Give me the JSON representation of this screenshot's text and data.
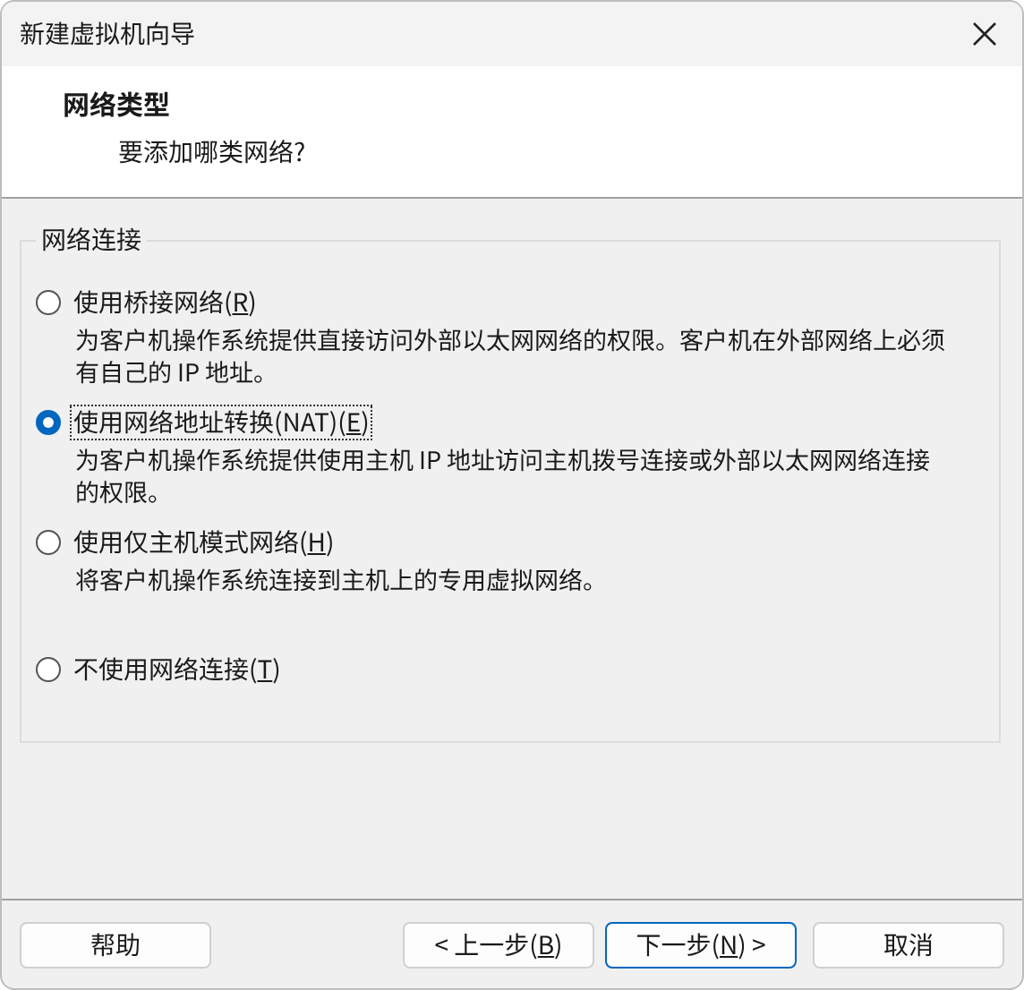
{
  "window": {
    "title": "新建虚拟机向导"
  },
  "header": {
    "title": "网络类型",
    "subtitle": "要添加哪类网络?"
  },
  "group": {
    "title": "网络连接",
    "options": [
      {
        "label_parts": [
          "使用桥接网络(",
          "R",
          ")"
        ],
        "description": "为客户机操作系统提供直接访问外部以太网网络的权限。客户机在外部网络上必须有自己的 IP 地址。",
        "selected": false,
        "focused": false
      },
      {
        "label_parts": [
          "使用网络地址转换(NAT)(",
          "E",
          ")"
        ],
        "description": "为客户机操作系统提供使用主机 IP 地址访问主机拨号连接或外部以太网网络连接的权限。",
        "selected": true,
        "focused": true
      },
      {
        "label_parts": [
          "使用仅主机模式网络(",
          "H",
          ")"
        ],
        "description": "将客户机操作系统连接到主机上的专用虚拟网络。",
        "selected": false,
        "focused": false
      },
      {
        "label_parts": [
          "不使用网络连接(",
          "T",
          ")"
        ],
        "selected": false,
        "focused": false
      }
    ]
  },
  "buttons": [
    {
      "kind": "help",
      "label_parts": [
        "帮助"
      ],
      "default": false
    },
    {
      "kind": "back",
      "label_parts": [
        "< 上一步(",
        "B",
        ")"
      ],
      "default": false
    },
    {
      "kind": "next",
      "label_parts": [
        "下一步(",
        "N",
        ") >"
      ],
      "default": true
    },
    {
      "kind": "cancel",
      "label_parts": [
        "取消"
      ],
      "default": false
    }
  ]
}
